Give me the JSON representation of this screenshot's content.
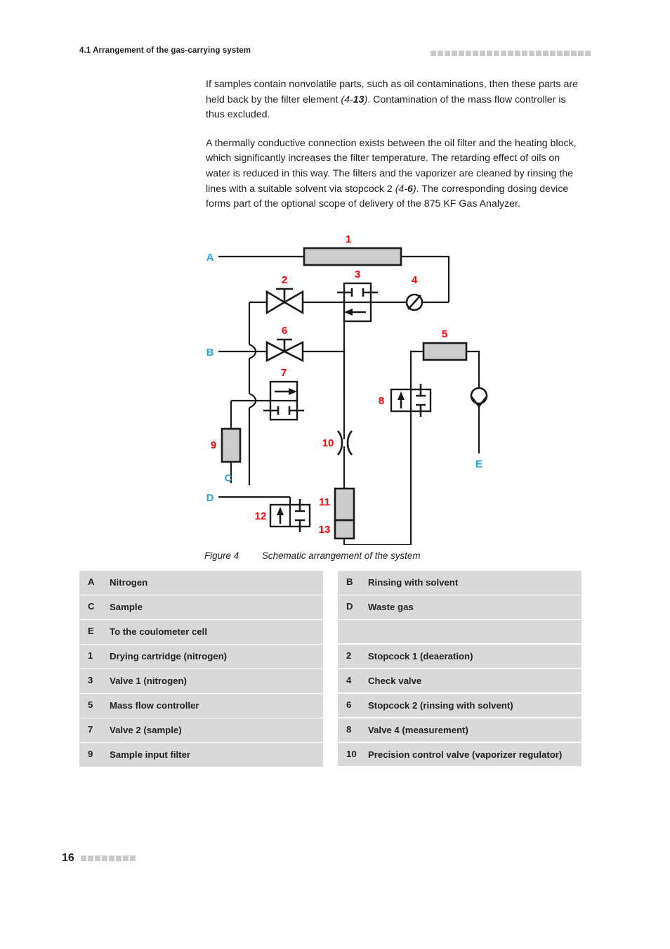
{
  "header": {
    "title": "4.1 Arrangement of the gas-carrying system",
    "square_count": 23
  },
  "body": {
    "paragraph1_part1": "If samples contain nonvolatile parts, such as oil contaminations, then these parts are held back by the filter element ",
    "paragraph1_ref_prefix": "(4-",
    "paragraph1_ref_bold": "13",
    "paragraph1_ref_suffix": ")",
    "paragraph1_part2": ". Contamination of the mass flow controller is thus excluded.",
    "paragraph2_part1": "A thermally conductive connection exists between the oil filter and the heating block, which significantly increases the filter temperature. The retarding effect of oils on water is reduced in this way. The filters and the vaporizer are cleaned by rinsing the lines with a suitable solvent via stopcock 2 ",
    "paragraph2_ref_prefix": "(4-",
    "paragraph2_ref_bold": "6",
    "paragraph2_ref_suffix": ")",
    "paragraph2_part2": ". The corresponding dosing device forms part of the optional scope of delivery of the 875 KF Gas Analyzer."
  },
  "figure": {
    "caption_number": "Figure 4",
    "caption_text": "Schematic arrangement of the system",
    "port_labels": {
      "A": "A",
      "B": "B",
      "C": "C",
      "D": "D",
      "E": "E"
    },
    "item_numbers": {
      "n1": "1",
      "n2": "2",
      "n3": "3",
      "n4": "4",
      "n5": "5",
      "n6": "6",
      "n7": "7",
      "n8": "8",
      "n9": "9",
      "n10": "10",
      "n11": "11",
      "n12": "12",
      "n13": "13"
    },
    "colors": {
      "port_label": "#29a3dc",
      "item_number": "#ff0000",
      "component_fill": "#cccccc",
      "line": "#1a1a1a"
    }
  },
  "legend": {
    "left_column": [
      {
        "key": "A",
        "value": "Nitrogen",
        "shaded": true
      },
      {
        "key": "C",
        "value": "Sample",
        "shaded": true
      },
      {
        "key": "E",
        "value": "To the coulometer cell",
        "shaded": true
      },
      {
        "key": "1",
        "value": "Drying cartridge (nitrogen)",
        "shaded": true
      },
      {
        "key": "3",
        "value": "Valve 1 (nitrogen)",
        "shaded": true
      },
      {
        "key": "5",
        "value": "Mass flow controller",
        "shaded": true
      },
      {
        "key": "7",
        "value": "Valve 2 (sample)",
        "shaded": true
      },
      {
        "key": "9",
        "value": "Sample input filter",
        "shaded": true
      }
    ],
    "right_column": [
      {
        "key": "B",
        "value": "Rinsing with solvent",
        "shaded": true
      },
      {
        "key": "D",
        "value": "Waste gas",
        "shaded": true
      },
      {
        "key": "",
        "value": "",
        "shaded": true
      },
      {
        "key": "2",
        "value": "Stopcock 1 (deaeration)",
        "shaded": true
      },
      {
        "key": "4",
        "value": "Check valve",
        "shaded": true
      },
      {
        "key": "6",
        "value": "Stopcock 2 (rinsing with solvent)",
        "shaded": true
      },
      {
        "key": "8",
        "value": "Valve 4 (measurement)",
        "shaded": true
      },
      {
        "key": "10",
        "value": "Precision control valve (vaporizer regulator)",
        "shaded": true
      }
    ]
  },
  "footer": {
    "page_number": "16",
    "square_count": 8
  }
}
